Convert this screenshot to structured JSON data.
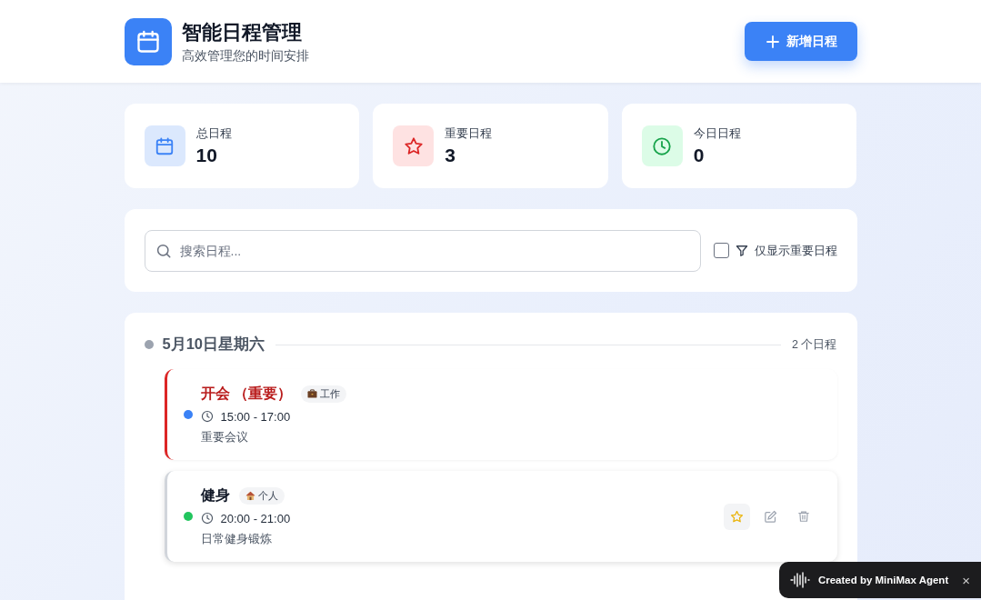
{
  "header": {
    "title": "智能日程管理",
    "subtitle": "高效管理您的时间安排",
    "add_button": "新增日程"
  },
  "stats": [
    {
      "kind": "total",
      "label": "总日程",
      "value": "10"
    },
    {
      "kind": "important",
      "label": "重要日程",
      "value": "3"
    },
    {
      "kind": "today",
      "label": "今日日程",
      "value": "0"
    }
  ],
  "search": {
    "placeholder": "搜索日程...",
    "filter_label": "仅显示重要日程",
    "checked": false
  },
  "days": [
    {
      "date": "5月10日星期六",
      "count": "2 个日程",
      "events": [
        {
          "title": "开会",
          "important": true,
          "important_label": "（重要）",
          "tag": {
            "kind": "work",
            "label": "工作"
          },
          "color": "#3b82f6",
          "time": "15:00 - 17:00",
          "note": "重要会议",
          "hovered": false
        },
        {
          "title": "健身",
          "important": false,
          "tag": {
            "kind": "personal",
            "label": "个人"
          },
          "color": "#22c55e",
          "time": "20:00 - 21:00",
          "note": "日常健身锻炼",
          "hovered": true
        }
      ]
    }
  ],
  "badge": {
    "text": "Created by MiniMax Agent",
    "close": "×"
  }
}
